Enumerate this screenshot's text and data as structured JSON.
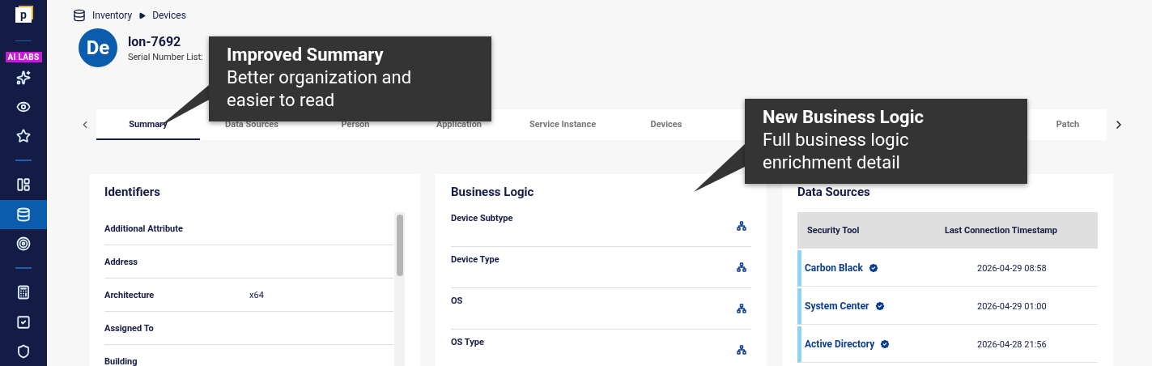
{
  "sidebar": {
    "logo": "p",
    "badge": "AI LABS",
    "sections": [
      [
        {
          "kind": "sparkles",
          "selected": false
        },
        {
          "kind": "eye",
          "selected": false
        },
        {
          "kind": "star",
          "selected": false
        }
      ],
      [
        {
          "kind": "layout",
          "selected": false
        },
        {
          "kind": "database",
          "selected": true
        },
        {
          "kind": "target",
          "selected": false
        }
      ],
      [
        {
          "kind": "calculator",
          "selected": false
        },
        {
          "kind": "checkbox",
          "selected": false
        },
        {
          "kind": "shield",
          "selected": false
        }
      ]
    ]
  },
  "breadcrumb": [
    "Inventory",
    "Devices"
  ],
  "header": {
    "avatar": "De",
    "title": "lon-7692",
    "subtitle": "Serial Number List:"
  },
  "tabs": [
    {
      "label": "Summary",
      "selected": true
    },
    {
      "label": "Data Sources",
      "selected": false
    },
    {
      "label": "Person",
      "selected": false
    },
    {
      "label": "Application",
      "selected": false
    },
    {
      "label": "Service Instance",
      "selected": false
    },
    {
      "label": "Devices",
      "selected": false
    },
    {
      "label": "Patch",
      "selected": false
    }
  ],
  "identifiers": {
    "title": "Identifiers",
    "rows": [
      {
        "label": "Additional Attribute"
      },
      {
        "label": "Address"
      },
      {
        "label": "Architecture",
        "value": "x64"
      },
      {
        "label": "Assigned To"
      },
      {
        "label": "Building"
      }
    ]
  },
  "business_logic": {
    "title": "Business Logic",
    "rows": [
      "Device Subtype",
      "Device Type",
      "OS",
      "OS Type"
    ]
  },
  "data_sources": {
    "title": "Data Sources",
    "columns": [
      "Security Tool",
      "Last Connection Timestamp"
    ],
    "rows": [
      {
        "tool": "Carbon Black",
        "timestamp": "2026-04-29 08:58",
        "verified": true
      },
      {
        "tool": "System Center",
        "timestamp": "2026-04-29 01:00",
        "verified": true
      },
      {
        "tool": "Active Directory",
        "timestamp": "2026-04-28 21:56",
        "verified": true
      }
    ]
  },
  "callouts": [
    {
      "title": "Improved Summary",
      "text": "Better organization and easier to read"
    },
    {
      "title": "New Business Logic",
      "text": "Full business logic enrichment detail"
    }
  ]
}
